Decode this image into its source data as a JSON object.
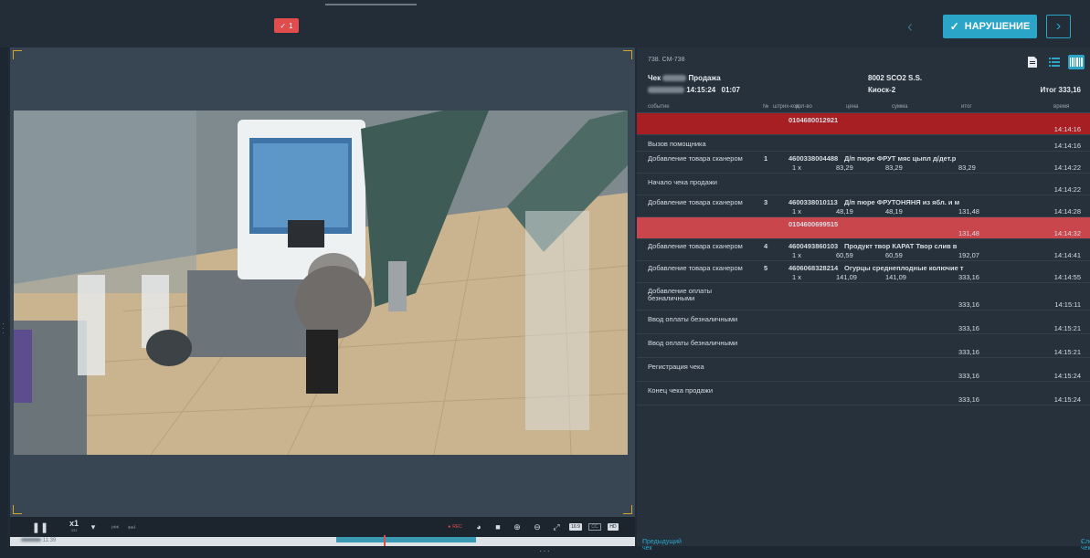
{
  "header": {
    "badge_count": "1",
    "violation_label": "НАРУШЕНИЕ"
  },
  "receipt": {
    "camera_id": "738. CM-738",
    "check_label": "Чек",
    "sale_label": "Продажа",
    "time_label": "14:15:24",
    "duration": "01:07",
    "terminal": "8002 SCO2 S.S.",
    "kiosk": "Киоск-2",
    "total": "Итог 333,16"
  },
  "columns": {
    "event": "событие",
    "num": "№",
    "barcode": "штрих-код",
    "qty": "кол-во",
    "price": "цена",
    "sum": "сумма",
    "total": "итог",
    "time": "время"
  },
  "rows": [
    {
      "kind": "red-dark",
      "event": "",
      "barcode": "0104680012921",
      "time": "14:14:16"
    },
    {
      "kind": "normal",
      "event": "Вызов помощника",
      "time": "14:14:16"
    },
    {
      "kind": "normal",
      "event": "Добавление товара сканером",
      "num": "1",
      "barcode": "4600338004488",
      "product": "Д/п пюре ФРУТ мяс цыпл д/дет.р",
      "qty": "1 x",
      "price": "83,29",
      "sum": "83,29",
      "total": "83,29",
      "time": "14:14:22"
    },
    {
      "kind": "normal",
      "event": "Начало чека продажи",
      "time": "14:14:22"
    },
    {
      "kind": "normal",
      "event": "Добавление товара сканером",
      "num": "3",
      "barcode": "4600338010113",
      "product": "Д/п пюре ФРУТОНЯНЯ из ябл. и м",
      "qty": "1 x",
      "price": "48,19",
      "sum": "48,19",
      "total": "131,48",
      "time": "14:14:28"
    },
    {
      "kind": "red-light",
      "event": "",
      "barcode": "0104600699515",
      "total": "131,48",
      "time": "14:14:32"
    },
    {
      "kind": "normal",
      "event": "Добавление товара сканером",
      "num": "4",
      "barcode": "4600493860103",
      "product": "Продукт твор КАРАТ Твор слив в",
      "qty": "1 x",
      "price": "60,59",
      "sum": "60,59",
      "total": "192,07",
      "time": "14:14:41"
    },
    {
      "kind": "normal",
      "event": "Добавление товара сканером",
      "num": "5",
      "barcode": "4606068328214",
      "product": "Огурцы среднеплодные колючие т",
      "qty": "1 x",
      "price": "141,09",
      "sum": "141,09",
      "total": "333,16",
      "time": "14:14:55"
    },
    {
      "kind": "normal",
      "event": "Добавление оплаты безналичными",
      "total": "333,16",
      "time": "14:15:11"
    },
    {
      "kind": "normal",
      "event": "Ввод оплаты безналичными",
      "total": "333,16",
      "time": "14:15:21"
    },
    {
      "kind": "normal",
      "event": "Ввод оплаты безналичными",
      "total": "333,16",
      "time": "14:15:21"
    },
    {
      "kind": "normal",
      "event": "Регистрация чека",
      "total": "333,16",
      "time": "14:15:24"
    },
    {
      "kind": "normal",
      "event": "Конец чека продажи",
      "total": "333,16",
      "time": "14:15:24"
    }
  ],
  "footer": {
    "prev_check": "Предыдущий чек",
    "next_check": "Следующий чек"
  },
  "player": {
    "speed": "x1",
    "speed_sub": "333",
    "rec": "REC",
    "timeline_start": "11:39",
    "badge_16x9": "16:9",
    "badge_cc": "CC",
    "badge_hd": "HD"
  },
  "colors": {
    "accent": "#2aa5c8",
    "alert_dark": "#a71f22",
    "alert_light": "#c9474c",
    "frame": "#d5a531"
  }
}
